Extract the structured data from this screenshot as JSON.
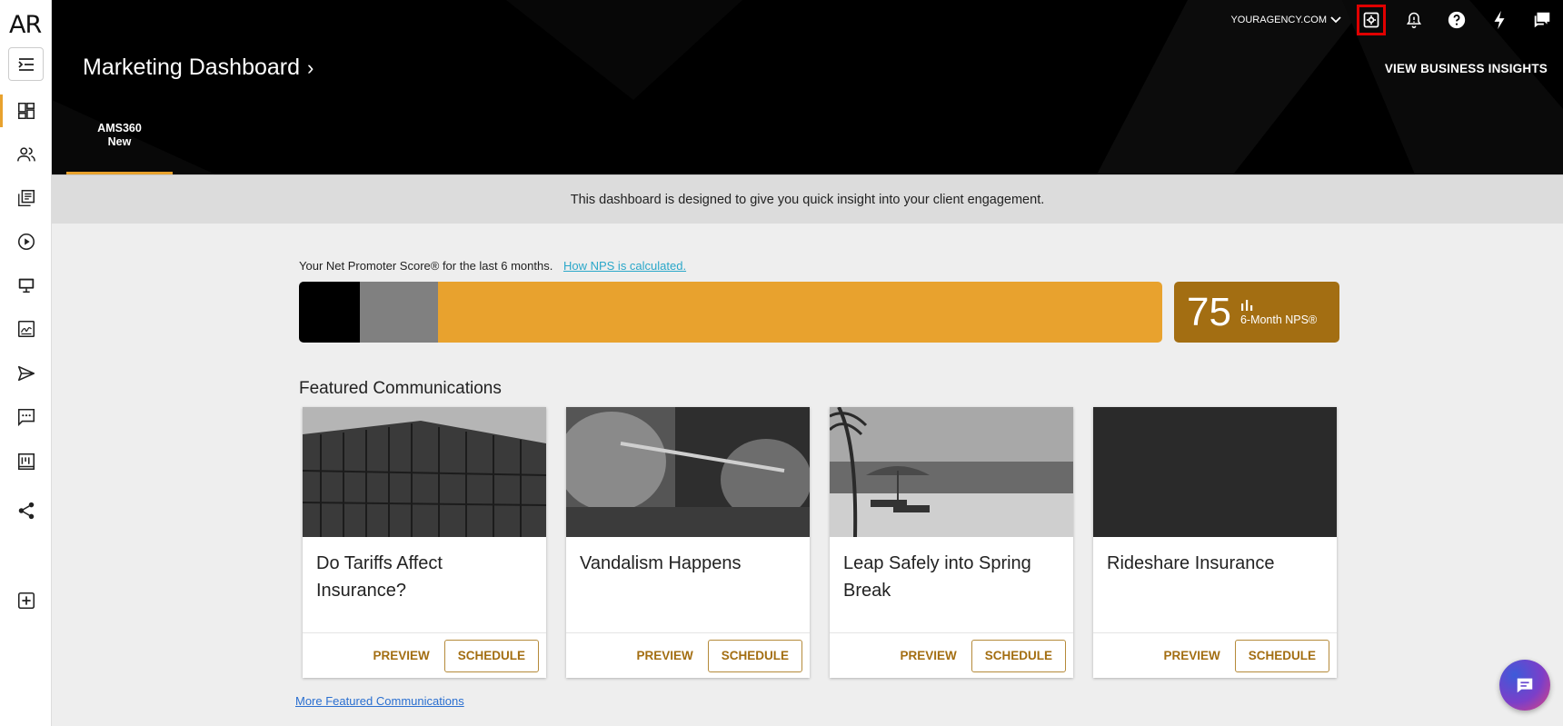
{
  "sidebar": {
    "logo": "AR",
    "items": [
      {
        "icon": "dashboard-icon"
      },
      {
        "icon": "contacts-icon"
      },
      {
        "icon": "library-icon"
      },
      {
        "icon": "play-icon"
      },
      {
        "icon": "monitor-icon"
      },
      {
        "icon": "signature-icon"
      },
      {
        "icon": "send-icon"
      },
      {
        "icon": "chat-icon"
      },
      {
        "icon": "board-icon"
      },
      {
        "icon": "share-icon"
      },
      {
        "icon": "add-box-icon"
      }
    ]
  },
  "header": {
    "title": "Marketing Dashboard",
    "agency": "YOURAGENCY.COM",
    "insights_label": "VIEW BUSINESS INSIGHTS",
    "tab_line1": "AMS360",
    "tab_line2": "New"
  },
  "info_text": "This dashboard is designed to give you quick insight into your client engagement.",
  "nps": {
    "label": "Your Net Promoter Score® for the last 6 months.",
    "link": "How NPS is calculated.",
    "score": "75",
    "score_label": "6-Month NPS®",
    "segments": [
      {
        "fraction": 0.071,
        "color": "#000000"
      },
      {
        "fraction": 0.09,
        "color": "#808080"
      },
      {
        "fraction": 0.839,
        "color": "#e8a22e"
      }
    ]
  },
  "featured": {
    "title": "Featured Communications",
    "cards": [
      {
        "title": "Do Tariffs Affect Insurance?",
        "preview": "PREVIEW",
        "schedule": "SCHEDULE"
      },
      {
        "title": "Vandalism Happens",
        "preview": "PREVIEW",
        "schedule": "SCHEDULE"
      },
      {
        "title": "Leap Safely into Spring Break",
        "preview": "PREVIEW",
        "schedule": "SCHEDULE"
      },
      {
        "title": "Rideshare Insurance",
        "preview": "PREVIEW",
        "schedule": "SCHEDULE"
      }
    ],
    "more_link": "More Featured Communications"
  },
  "colors": {
    "accent": "#e8a22e",
    "score_bg": "#a36e12",
    "link": "#2aa7c9",
    "highlight": "#e00000"
  }
}
